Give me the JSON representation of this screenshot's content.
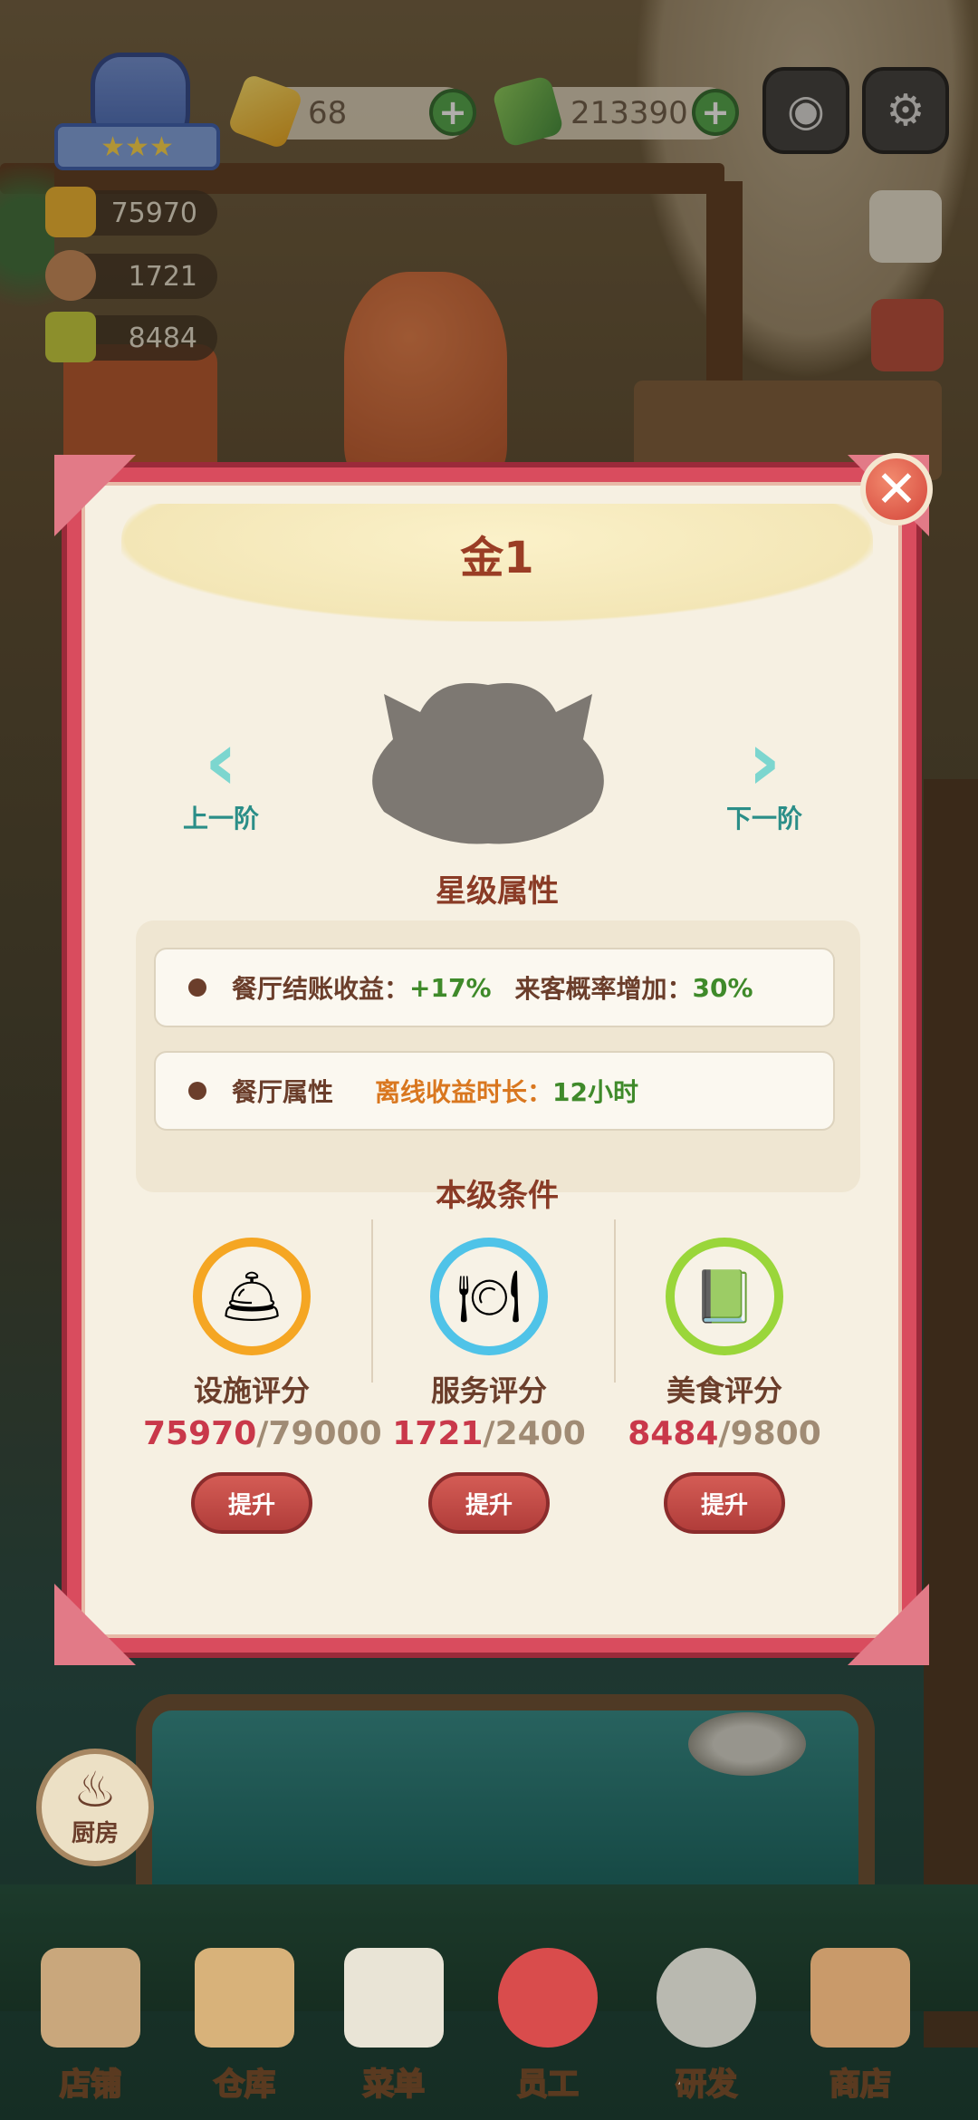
{
  "hud": {
    "gems": "68",
    "cash": "213390",
    "stats": [
      {
        "name": "facility",
        "value": "75970"
      },
      {
        "name": "service",
        "value": "1721"
      },
      {
        "name": "food",
        "value": "8484"
      }
    ],
    "badge_stars": "★★★"
  },
  "modal": {
    "title": "金1",
    "prev_label": "上一阶",
    "next_label": "下一阶",
    "prev_chevron": "‹",
    "next_chevron": "›",
    "close_glyph": "✕",
    "star_attrs_heading": "星级属性",
    "attr_row1": {
      "label1": "餐厅结账收益：",
      "value1": "+17%",
      "label2": "来客概率增加：",
      "value2": "30%"
    },
    "attr_row2": {
      "label": "餐厅属性",
      "label2": "离线收益时长：",
      "value2": "12小时"
    },
    "conditions_heading": "本级条件",
    "conditions": [
      {
        "name": "设施评分",
        "current": "75970",
        "max": "/79000",
        "button": "提升",
        "ring_color": "#f5a623",
        "icon": "🛎"
      },
      {
        "name": "服务评分",
        "current": "1721",
        "max": "/2400",
        "button": "提升",
        "ring_color": "#4fc3e8",
        "icon": "🍽"
      },
      {
        "name": "美食评分",
        "current": "8484",
        "max": "/9800",
        "button": "提升",
        "ring_color": "#9ad63a",
        "icon": "📗"
      }
    ]
  },
  "kitchen": {
    "label": "厨房"
  },
  "bottom_nav": [
    {
      "label": "店铺",
      "color": "#c9a77c"
    },
    {
      "label": "仓库",
      "color": "#d8b27a"
    },
    {
      "label": "菜单",
      "color": "#e9e4d6"
    },
    {
      "label": "员工",
      "color": "#d94c4c"
    },
    {
      "label": "研发",
      "color": "#b9b9b0"
    },
    {
      "label": "商店",
      "color": "#c99a6a"
    }
  ]
}
